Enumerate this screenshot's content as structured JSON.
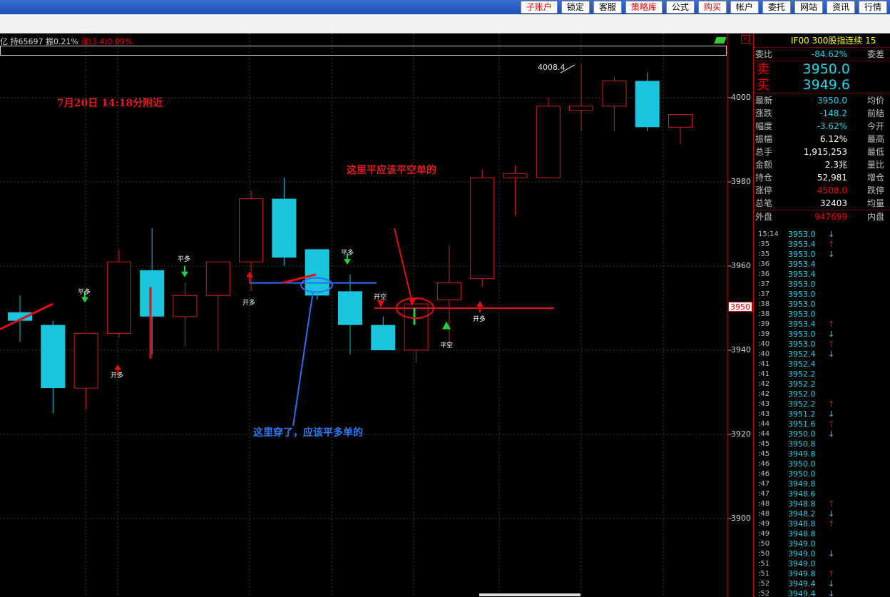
{
  "toolbar": {
    "buttons": [
      "子账户",
      "锁定",
      "客服",
      "策略库",
      "公式",
      "购买",
      "帐户",
      "委托",
      "网站",
      "资讯",
      "行情"
    ],
    "red_buttons": [
      "子账户",
      "策略库",
      "购买"
    ]
  },
  "info_line": {
    "left": "亿 持65697 振0.21%",
    "change": "涨(3.4)0.09%"
  },
  "chart_data": {
    "type": "candlestick",
    "y_ticks": [
      3900,
      3920,
      3940,
      3960,
      3980,
      4000
    ],
    "ylim": [
      3886,
      4016
    ],
    "high_label": "4008.4",
    "last_price_tag": "3950",
    "candles": [
      {
        "o": 3947,
        "h": 3953,
        "l": 3942,
        "c": 3949,
        "col": "c"
      },
      {
        "o": 3946,
        "h": 3947,
        "l": 3925,
        "c": 3931,
        "col": "c"
      },
      {
        "o": 3931,
        "h": 3944,
        "l": 3926,
        "c": 3944,
        "col": "r"
      },
      {
        "o": 3944,
        "h": 3964,
        "l": 3943,
        "c": 3961,
        "col": "r"
      },
      {
        "o": 3959,
        "h": 3969,
        "l": 3939,
        "c": 3948,
        "col": "c"
      },
      {
        "o": 3948,
        "h": 3956,
        "l": 3941,
        "c": 3953,
        "col": "r"
      },
      {
        "o": 3953,
        "h": 3961,
        "l": 3940,
        "c": 3961,
        "col": "r"
      },
      {
        "o": 3961,
        "h": 3978,
        "l": 3954,
        "c": 3976,
        "col": "r"
      },
      {
        "o": 3976,
        "h": 3981,
        "l": 3960,
        "c": 3962,
        "col": "c"
      },
      {
        "o": 3964,
        "h": 3964,
        "l": 3952,
        "c": 3953,
        "col": "c"
      },
      {
        "o": 3954,
        "h": 3958,
        "l": 3939,
        "c": 3946,
        "col": "c"
      },
      {
        "o": 3946,
        "h": 3948,
        "l": 3941,
        "c": 3940,
        "col": "c"
      },
      {
        "o": 3940,
        "h": 3951,
        "l": 3937,
        "c": 3951,
        "col": "r"
      },
      {
        "o": 3952,
        "h": 3965,
        "l": 3941,
        "c": 3956,
        "col": "r"
      },
      {
        "o": 3957,
        "h": 3983,
        "l": 3955,
        "c": 3981,
        "col": "r"
      },
      {
        "o": 3981,
        "h": 3984,
        "l": 3972,
        "c": 3982,
        "col": "r"
      },
      {
        "o": 3981,
        "h": 4000,
        "l": 3981,
        "c": 3998,
        "col": "r"
      },
      {
        "o": 3997,
        "h": 4008,
        "l": 3992,
        "c": 3998,
        "col": "r"
      },
      {
        "o": 3998,
        "h": 4005,
        "l": 3992,
        "c": 4004,
        "col": "r"
      },
      {
        "o": 4004,
        "h": 4006,
        "l": 3992,
        "c": 3993,
        "col": "c"
      },
      {
        "o": 3996,
        "h": 3996,
        "l": 3989,
        "c": 3993,
        "col": "r"
      }
    ]
  },
  "annotations": {
    "date": "7月20日 14:18分附近",
    "red_note": "这里平应该平空单的",
    "blue_note": "这里穿了，应该平多单的"
  },
  "signals": [
    {
      "text": "平多",
      "ci": 3,
      "kind": "down",
      "price": 3956
    },
    {
      "text": "开多",
      "ci": 4,
      "kind": "up",
      "price": 3934
    },
    {
      "text": "平多",
      "ci": 7,
      "kind": "down",
      "price": 3959
    },
    {
      "text": "开多",
      "ci": 9,
      "kind": "up",
      "price": 3950
    },
    {
      "text": "平多",
      "ci": 12,
      "kind": "down",
      "price": 3960
    },
    {
      "text": "开空",
      "ci": 13,
      "kind": "down",
      "price": 3949
    },
    {
      "text": "平空",
      "ci": 16,
      "kind": "up",
      "price": 3944
    },
    {
      "text": "开多",
      "ci": 17,
      "kind": "up",
      "price": 3948
    }
  ],
  "right_panel": {
    "title": "IF00  300股指连续  15",
    "weibi": {
      "label": "委比",
      "value": "-84.62%",
      "label2": "委差"
    },
    "sell": {
      "label": "卖",
      "value": "3950.0"
    },
    "buy": {
      "label": "买",
      "value": "3949.6"
    },
    "stats": [
      {
        "l": "最新",
        "v": "3950.0",
        "vc": "cyan",
        "r": "均价"
      },
      {
        "l": "涨跌",
        "v": "-148.2",
        "vc": "cyan",
        "r": "前结"
      },
      {
        "l": "幅度",
        "v": "-3.62%",
        "vc": "cyan",
        "r": "今开"
      },
      {
        "l": "振幅",
        "v": "6.12%",
        "vc": "white",
        "r": "最高"
      },
      {
        "l": "总手",
        "v": "1,915,253",
        "vc": "white",
        "r": "最低"
      },
      {
        "l": "金额",
        "v": "2.3兆",
        "vc": "white",
        "r": "量比"
      },
      {
        "l": "持仓",
        "v": "52,981",
        "vc": "white",
        "r": "增仓"
      },
      {
        "l": "涨停",
        "v": "4508.0",
        "vc": "red",
        "r": "跌停"
      },
      {
        "l": "总笔",
        "v": "32403",
        "vc": "white",
        "r": "均量"
      },
      {
        "l": "外盘",
        "v": "947699",
        "vc": "red",
        "r": "内盘"
      }
    ],
    "ticks": [
      {
        "t": "15:14",
        "p": "3953.0",
        "a": "↓"
      },
      {
        "t": ":35",
        "p": "3953.4",
        "a": "↑"
      },
      {
        "t": ":35",
        "p": "3953.0",
        "a": "↓"
      },
      {
        "t": ":36",
        "p": "3953.4",
        "a": ""
      },
      {
        "t": ":36",
        "p": "3953.4",
        "a": ""
      },
      {
        "t": ":37",
        "p": "3953.0",
        "a": ""
      },
      {
        "t": ":37",
        "p": "3953.0",
        "a": ""
      },
      {
        "t": ":38",
        "p": "3953.0",
        "a": ""
      },
      {
        "t": ":38",
        "p": "3953.0",
        "a": ""
      },
      {
        "t": ":39",
        "p": "3953.4",
        "a": "↑"
      },
      {
        "t": ":39",
        "p": "3953.0",
        "a": "↓"
      },
      {
        "t": ":40",
        "p": "3953.0",
        "a": "↑"
      },
      {
        "t": ":40",
        "p": "3952.4",
        "a": "↓"
      },
      {
        "t": ":41",
        "p": "3952.4",
        "a": ""
      },
      {
        "t": ":41",
        "p": "3952.2",
        "a": ""
      },
      {
        "t": ":42",
        "p": "3952.2",
        "a": ""
      },
      {
        "t": ":42",
        "p": "3952.0",
        "a": ""
      },
      {
        "t": ":43",
        "p": "3952.2",
        "a": "↑"
      },
      {
        "t": ":43",
        "p": "3951.2",
        "a": "↓"
      },
      {
        "t": ":44",
        "p": "3951.6",
        "a": "↑"
      },
      {
        "t": ":44",
        "p": "3950.0",
        "a": "↓"
      },
      {
        "t": ":45",
        "p": "3950.8",
        "a": ""
      },
      {
        "t": ":45",
        "p": "3949.8",
        "a": ""
      },
      {
        "t": ":46",
        "p": "3950.0",
        "a": ""
      },
      {
        "t": ":46",
        "p": "3950.0",
        "a": ""
      },
      {
        "t": ":47",
        "p": "3949.8",
        "a": ""
      },
      {
        "t": ":47",
        "p": "3948.6",
        "a": ""
      },
      {
        "t": ":48",
        "p": "3948.8",
        "a": "↑"
      },
      {
        "t": ":48",
        "p": "3948.2",
        "a": "↓"
      },
      {
        "t": ":49",
        "p": "3948.8",
        "a": "↑"
      },
      {
        "t": ":49",
        "p": "3948.8",
        "a": ""
      },
      {
        "t": ":50",
        "p": "3949.0",
        "a": ""
      },
      {
        "t": ":50",
        "p": "3949.0",
        "a": "↓"
      },
      {
        "t": ":51",
        "p": "3949.0",
        "a": ""
      },
      {
        "t": ":51",
        "p": "3949.8",
        "a": "↑"
      },
      {
        "t": ":52",
        "p": "3949.4",
        "a": "↓"
      },
      {
        "t": ":52",
        "p": "3949.4",
        "a": "↓"
      }
    ]
  }
}
